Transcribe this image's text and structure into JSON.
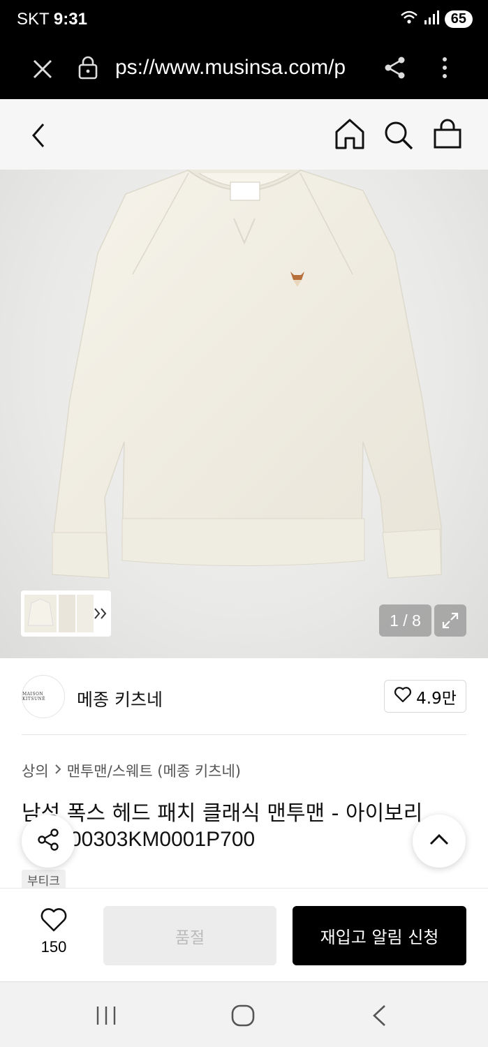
{
  "status": {
    "carrier": "SKT",
    "time": "9:31",
    "battery": "65"
  },
  "browser": {
    "url": "ps://www.musinsa.com/p"
  },
  "product": {
    "image_counter": "1 / 8",
    "brand": "메종 키츠네",
    "brand_logo_text": "MAISON KITSUNÉ",
    "brand_likes": "4.9만",
    "breadcrumb": {
      "category": "상의",
      "sub": "맨투맨/스웨트 (메종 키츠네)"
    },
    "title_line1": "남성 폭스 헤드 패치 클래식 맨투맨 - 아이보리",
    "title_line2": "00303KM0001P700",
    "tag": "부티크"
  },
  "actions": {
    "wish_count": "150",
    "soldout_label": "품절",
    "restock_label": "재입고 알림 신청"
  },
  "colors": {
    "accent": "#000000",
    "sweatshirt": "#f2efe6"
  }
}
